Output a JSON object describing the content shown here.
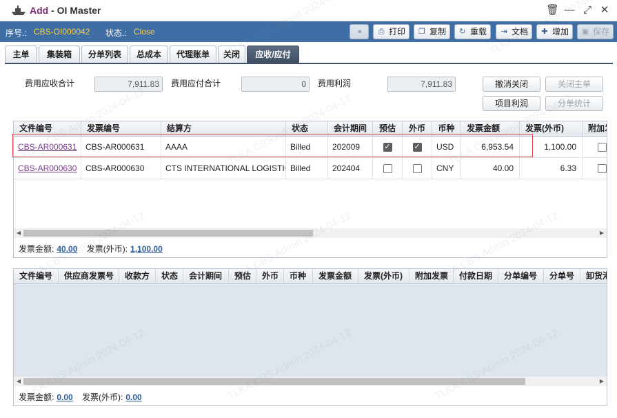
{
  "window": {
    "title_prefix": "Add",
    "title_rest": " - OI Master",
    "controls": {
      "delete": "🗑",
      "minimize": "—",
      "maximize": "⤢",
      "close": "✕"
    }
  },
  "info": {
    "seq_label": "序号.:",
    "seq_value": "CBS-OI000042",
    "status_label": "状态.:",
    "status_value": "Close"
  },
  "toolbar": {
    "print": "打印",
    "copy": "复制",
    "reload": "重载",
    "docs": "文档",
    "add": "增加",
    "save": "保存"
  },
  "tabs": [
    "主单",
    "集装箱",
    "分单列表",
    "总成本",
    "代理账单",
    "关闭",
    "应收/应付"
  ],
  "summary": {
    "receivable_label": "费用应收合计",
    "receivable_value": "7,911.83",
    "payable_label": "费用应付合计",
    "payable_value": "0",
    "profit_label": "费用利润",
    "profit_value": "7,911.83"
  },
  "actions": {
    "cancel_close": "撤消关闭",
    "close_master": "关闭主单",
    "project_profit": "项目利润",
    "split_stats": "分单统计"
  },
  "ar_grid": {
    "columns": [
      "文件编号",
      "发票编号",
      "结算方",
      "状态",
      "会计期间",
      "预估",
      "外币",
      "币种",
      "发票金额",
      "发票(外币)",
      "附加发"
    ],
    "rows": [
      {
        "file_no": "CBS-AR000631",
        "invoice_no": "CBS-AR000631",
        "party": "AAAA",
        "status": "Billed",
        "period": "202009",
        "estimate": true,
        "foreign": true,
        "currency": "USD",
        "amount": "6,953.54",
        "amount_fc": "1,100.00",
        "extra": false
      },
      {
        "file_no": "CBS-AR000630",
        "invoice_no": "CBS-AR000630",
        "party": "CTS INTERNATIONAL LOGISTIC",
        "status": "Billed",
        "period": "202404",
        "estimate": false,
        "foreign": false,
        "currency": "CNY",
        "amount": "40.00",
        "amount_fc": "6.33",
        "extra": false
      }
    ],
    "totals": {
      "amount_label": "发票金额:",
      "amount_value": "40.00",
      "fc_label": "发票(外币):",
      "fc_value": "1,100.00"
    }
  },
  "ap_grid": {
    "columns": [
      "文件编号",
      "供应商发票号",
      "收款方",
      "状态",
      "会计期间",
      "预估",
      "外币",
      "币种",
      "发票金额",
      "发票(外币)",
      "附加发票",
      "付款日期",
      "分单编号",
      "分单号",
      "卸货港"
    ],
    "totals": {
      "amount_label": "发票金额:",
      "amount_value": "0.00",
      "fc_label": "发票(外币):",
      "fc_value": "0.00"
    }
  },
  "watermark": "TLKA.CBS.Admin 2024-04-12",
  "colors": {
    "infobar": "#3f6ea5",
    "status_value": "#ffd23c",
    "tab_active": "#3f4e62",
    "highlight": "#e0474c"
  }
}
